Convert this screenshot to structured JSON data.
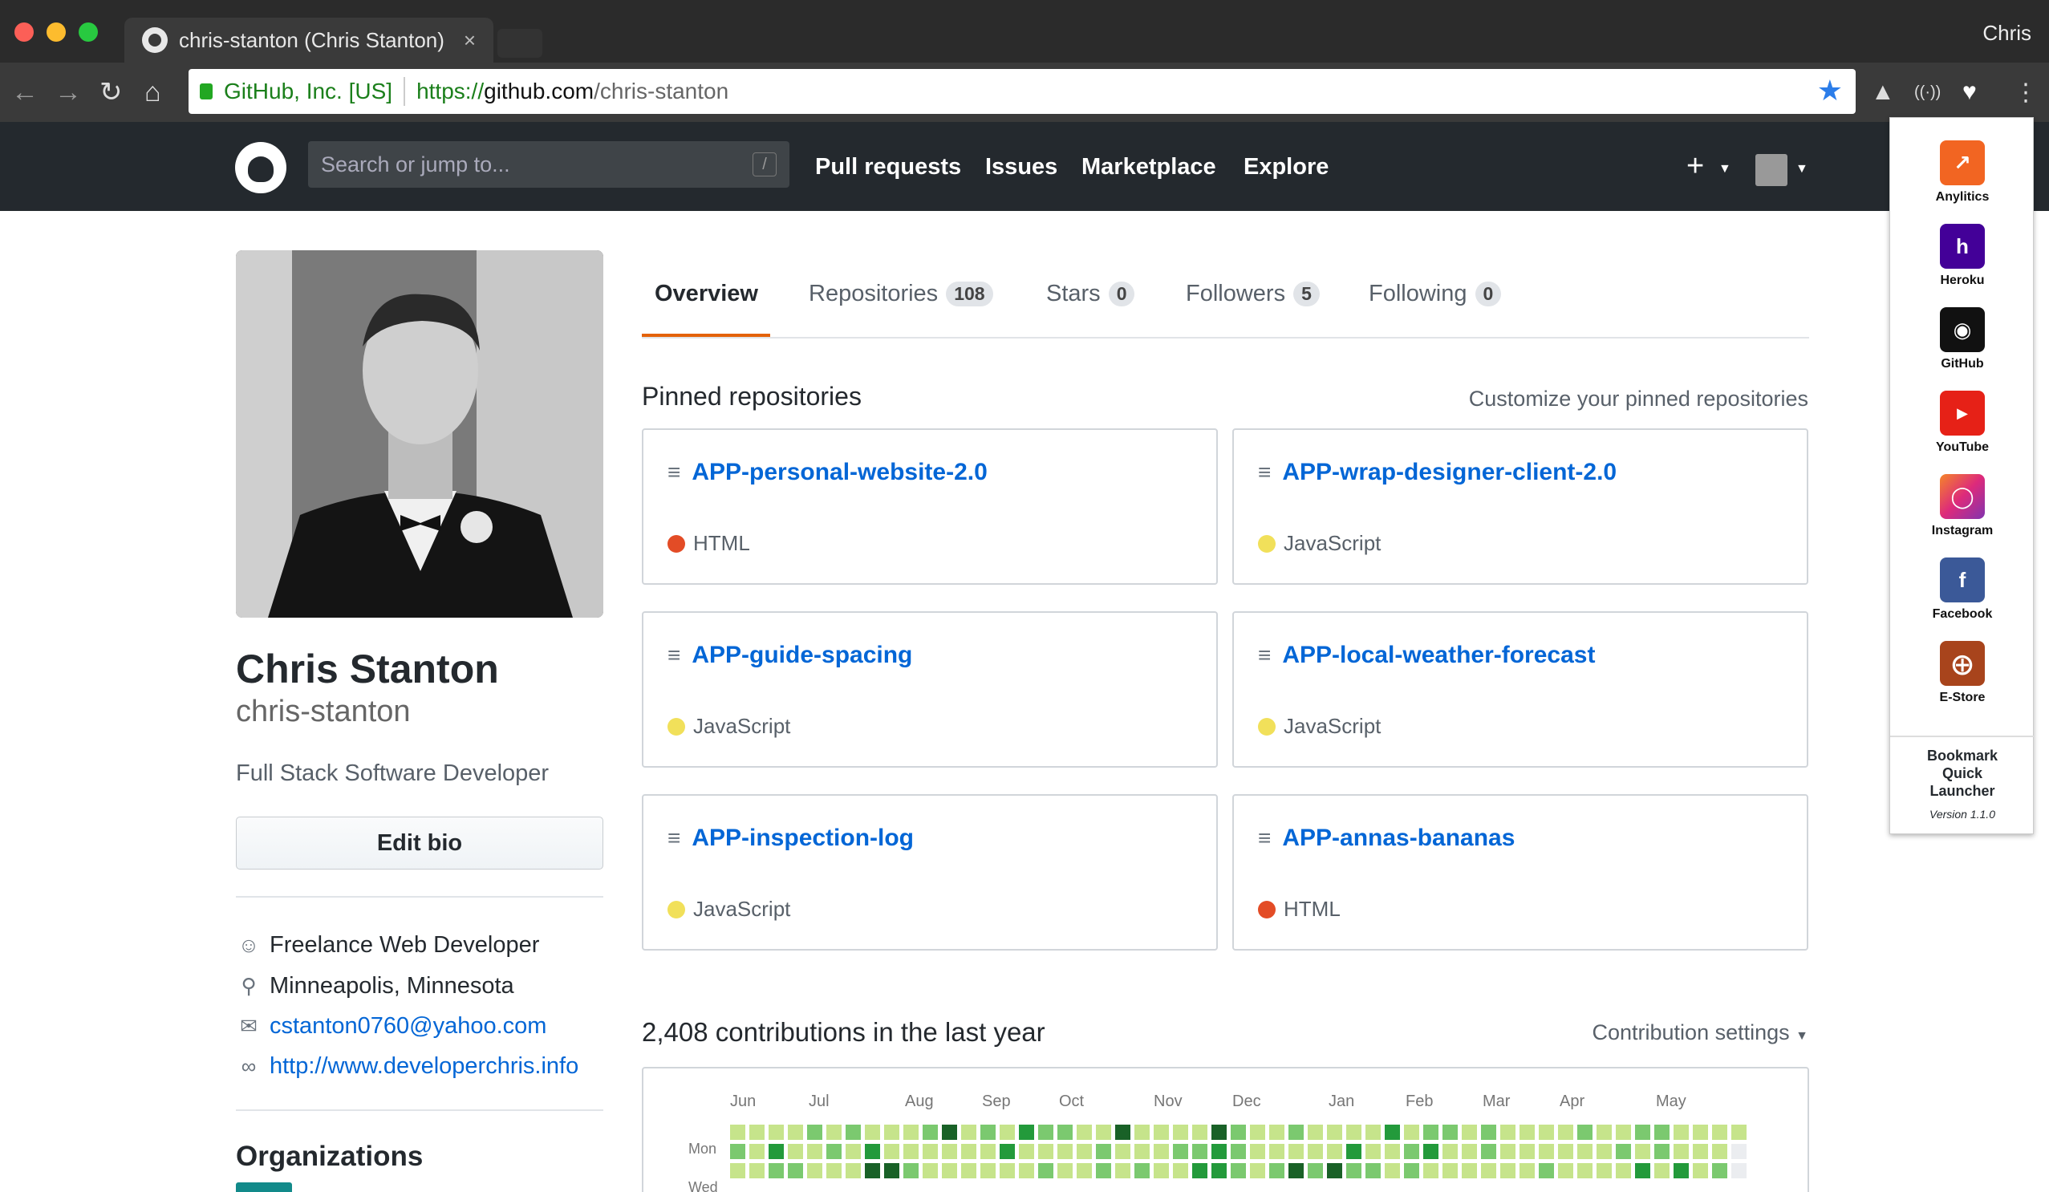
{
  "browser": {
    "tab_title": "chris-stanton (Chris Stanton)",
    "tab_close": "×",
    "user_label": "Chris",
    "url_secure_label": "GitHub, Inc. [US]",
    "url_scheme": "https://",
    "url_host": "github.com",
    "url_path": "/chris-stanton"
  },
  "github_header": {
    "search_placeholder": "Search or jump to...",
    "search_shortcut": "/",
    "nav": [
      "Pull requests",
      "Issues",
      "Marketplace",
      "Explore"
    ],
    "plus_label": "+"
  },
  "profile": {
    "full_name": "Chris Stanton",
    "login": "chris-stanton",
    "bio": "Full Stack Software Developer",
    "edit_bio_label": "Edit bio",
    "company": "Freelance Web Developer",
    "location": "Minneapolis, Minnesota",
    "email": "cstanton0760@yahoo.com",
    "website": "http://www.developerchris.info",
    "organizations_heading": "Organizations"
  },
  "tabs": [
    {
      "label": "Overview",
      "count": ""
    },
    {
      "label": "Repositories",
      "count": "108"
    },
    {
      "label": "Stars",
      "count": "0"
    },
    {
      "label": "Followers",
      "count": "5"
    },
    {
      "label": "Following",
      "count": "0"
    }
  ],
  "pinned": {
    "heading": "Pinned repositories",
    "customize_label": "Customize your pinned repositories",
    "repos": [
      {
        "name": "APP-personal-website-2.0",
        "language": "HTML",
        "color": "#e34c26"
      },
      {
        "name": "APP-wrap-designer-client-2.0",
        "language": "JavaScript",
        "color": "#f1e05a"
      },
      {
        "name": "APP-guide-spacing",
        "language": "JavaScript",
        "color": "#f1e05a"
      },
      {
        "name": "APP-local-weather-forecast",
        "language": "JavaScript",
        "color": "#f1e05a"
      },
      {
        "name": "APP-inspection-log",
        "language": "JavaScript",
        "color": "#f1e05a"
      },
      {
        "name": "APP-annas-bananas",
        "language": "HTML",
        "color": "#e34c26"
      }
    ]
  },
  "contributions": {
    "heading": "2,408 contributions in the last year",
    "settings_label": "Contribution settings",
    "months": [
      "Jun",
      "Jul",
      "Aug",
      "Sep",
      "Oct",
      "Nov",
      "Dec",
      "Jan",
      "Feb",
      "Mar",
      "Apr",
      "May"
    ],
    "day_labels": [
      "Mon",
      "Wed"
    ],
    "level_colors": [
      "#ebedf0",
      "#c6e48b",
      "#7bc96f",
      "#239a3b",
      "#196127"
    ]
  },
  "extension": {
    "items": [
      {
        "label": "Anylitics",
        "icon": "analytics-icon",
        "color": "#f26522"
      },
      {
        "label": "Heroku",
        "icon": "heroku-icon",
        "color": "#430098"
      },
      {
        "label": "GitHub",
        "icon": "github-icon",
        "color": "#111111"
      },
      {
        "label": "YouTube",
        "icon": "youtube-icon",
        "color": "#e62117"
      },
      {
        "label": "Instagram",
        "icon": "instagram-icon",
        "color": "#c13584"
      },
      {
        "label": "Facebook",
        "icon": "facebook-icon",
        "color": "#3b5998"
      },
      {
        "label": "E-Store",
        "icon": "estore-icon",
        "color": "#a8441c"
      }
    ],
    "footer_line1": "Bookmark",
    "footer_line2": "Quick",
    "footer_line3": "Launcher",
    "version": "Version 1.1.0"
  }
}
